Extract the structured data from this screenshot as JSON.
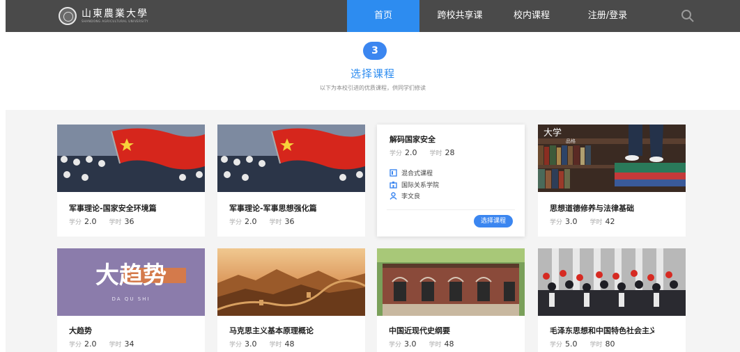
{
  "header": {
    "logo_text": "山東農業大學",
    "logo_en": "SHANDONG AGRICULTURAL UNIVERSITY",
    "nav": [
      {
        "label": "首页",
        "active": true
      },
      {
        "label": "跨校共享课"
      },
      {
        "label": "校内课程"
      },
      {
        "label": "注册/登录"
      }
    ],
    "search_icon": "search-icon",
    "active_color": "#2d8cf0"
  },
  "intro": {
    "step": "3",
    "title": "选择课程",
    "subtitle": "以下为本校引进的优质课程，供同学们修读"
  },
  "labels": {
    "credit": "学分",
    "hours": "学时"
  },
  "courses": [
    {
      "title": "军事理论-国家安全环境篇",
      "credit": "2.0",
      "hours": "36"
    },
    {
      "title": "军事理论-军事思想强化篇",
      "credit": "2.0",
      "hours": "36"
    },
    {
      "title": "解码国家安全",
      "credit": "2.0",
      "hours": "28",
      "type": "混合式课程",
      "school": "国际关系学院",
      "teacher": "李文良",
      "button": "选择课程"
    },
    {
      "title": "思想道德修养与法律基础",
      "credit": "3.0",
      "hours": "42",
      "thumb_text": "大学",
      "thumb_sub": "品格"
    },
    {
      "title": "大趋势",
      "credit": "2.0",
      "hours": "34",
      "thumb_text": "大趋势",
      "thumb_sub": "DA   QU   SHI"
    },
    {
      "title": "马克思主义基本原理概论",
      "credit": "3.0",
      "hours": "48"
    },
    {
      "title": "中国近现代史纲要",
      "credit": "3.0",
      "hours": "48"
    },
    {
      "title": "毛泽东思想和中国特色社会主义理论体系概论",
      "credit": "5.0",
      "hours": "80"
    }
  ]
}
